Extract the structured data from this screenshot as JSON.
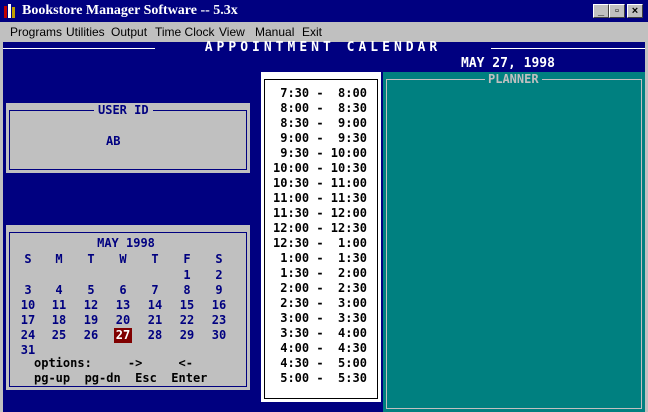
{
  "window": {
    "title": "Bookstore Manager Software -- 5.3x"
  },
  "menu": [
    "Programs",
    "Utilities",
    "Output",
    "Time Clock",
    "View",
    "Manual",
    "Exit"
  ],
  "header": {
    "title": "APPOINTMENT CALENDAR",
    "date": "MAY 27, 1998"
  },
  "user": {
    "title": "USER ID",
    "value": "AB"
  },
  "calendar": {
    "title": "MAY 1998",
    "weekdays": [
      "S",
      "M",
      "T",
      "W",
      "T",
      "F",
      "S"
    ],
    "weeks": [
      [
        "",
        "",
        "",
        "",
        "",
        "1",
        "2"
      ],
      [
        "3",
        "4",
        "5",
        "6",
        "7",
        "8",
        "9"
      ],
      [
        "10",
        "11",
        "12",
        "13",
        "14",
        "15",
        "16"
      ],
      [
        "17",
        "18",
        "19",
        "20",
        "21",
        "22",
        "23"
      ],
      [
        "24",
        "25",
        "26",
        "27",
        "28",
        "29",
        "30"
      ],
      [
        "31",
        "",
        "",
        "",
        "",
        "",
        ""
      ]
    ],
    "selected_day": "27",
    "options_line": "options:     ->     <-",
    "keys_line": "pg-up  pg-dn  Esc  Enter"
  },
  "time_slots": [
    " 7:30 -  8:00",
    " 8:00 -  8:30",
    " 8:30 -  9:00",
    " 9:00 -  9:30",
    " 9:30 - 10:00",
    "10:00 - 10:30",
    "10:30 - 11:00",
    "11:00 - 11:30",
    "11:30 - 12:00",
    "12:00 - 12:30",
    "12:30 -  1:00",
    " 1:00 -  1:30",
    " 1:30 -  2:00",
    " 2:00 -  2:30",
    " 2:30 -  3:00",
    " 3:00 -  3:30",
    " 3:30 -  4:00",
    " 4:00 -  4:30",
    " 4:30 -  5:00",
    " 5:00 -  5:30"
  ],
  "planner": {
    "title": "PLANNER"
  },
  "colors": {
    "background": "#000080",
    "planner": "#008080",
    "today": "#800000"
  }
}
